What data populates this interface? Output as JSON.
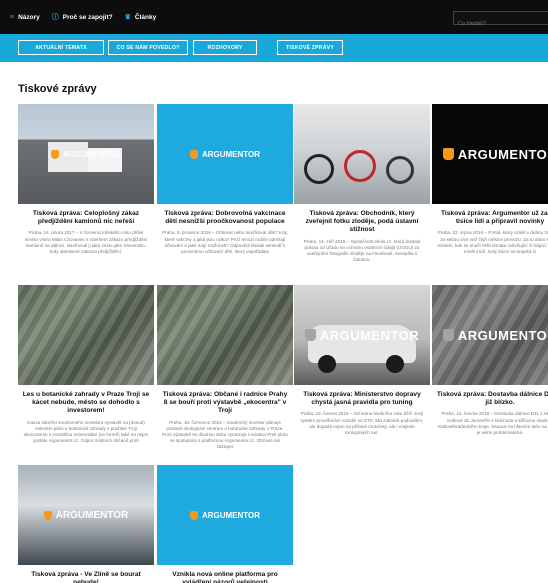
{
  "topnav": [
    {
      "icon": "≡",
      "label": "Názory"
    },
    {
      "icon": "ⓘ",
      "label": "Proč se zapojit?"
    },
    {
      "icon": "♛",
      "label": "Články"
    }
  ],
  "search": {
    "placeholder": "Co hledáš?"
  },
  "categories": [
    "AKTUÁLNÍ TÉMATA",
    "CO SE NÁM POVEDLO?",
    "ROZHOVORY",
    "TISKOVÉ ZPRÁVY"
  ],
  "page_title": "Tiskové zprávy",
  "brand": {
    "name": "ARGUMENTOR",
    "dot": "."
  },
  "cards": [
    {
      "title": "Tisková zpráva: Celoplošný zákaz předjíždění kamionů nic neřeší",
      "desc": "Praha, 14. února 2017 – V červenci loňského roku přišel ministr vnitra Milan Chovanec s návrhem zákazu předjíždění kamionů na dálnici. Navrhoval ji jako cestu jako Slovensko, tedy absolutně zákazat předjíždění."
    },
    {
      "title": "Tisková zpráva: Dobrovolná vakcinace dětí nesnížší proočkovanost populace",
      "desc": "Praha, 5. prosince 2016 – Očkovat nebo neočkovat děti? Kdy, které vakcíny a jaká jsou rizika? Proč mnozí rodiče odmítají očkování a jaké mají možnosti? Odpovědi hledali seminář k povinnému očkování dětí, který uspořádala"
    },
    {
      "title": "Tisková zpráva: Obchodník, který zveřejnil fotku zloděje, podá ústavní stížnost",
      "desc": "Praha, 14. září 2016 – Společnost ekolo.cz, která dostala pokutu od Úřadu na ochranu osobních údajů (ÚOOÚ) za uveřejnění fotografie zloděje na Facebook, neuspěla s žalobou."
    },
    {
      "title": "Tisková zpráva: Argumentor už zaujal tisíce lidí a připravil novinky",
      "desc": "Praha, 22. srpna 2016 – Portál, který vznikl v dubnu 2016 má za sebou více než čtyři měsíce provozu. Za tu dobu se stal místem, kde se snaží řešit témata ovlivňující či trápící veřejné mínění lidí. Svůj názor na krajská či"
    },
    {
      "title": "Les u botanické zahrady v Praze Troji se kácet nebude, město se dohodlo s investorem!",
      "desc": "Kauza záměru soukromého investora vystavět na (dosud) zeleném pláni u botanické zahrady v pražské Troji ekocentrum s rozsáhlou rezervoiální (ve formě) také na nejen portálu Argumentor.cz. Odpor místních občanů proti"
    },
    {
      "title": "Tisková zpráva: Občané i radnice Prahy 8 se bouří proti výstavbě „ekocentra\" v Troji",
      "desc": "Praha, 18. července 2016 – Soukromý investor plánuje postavit ekologické centrum u botanické zahrady v Praze. Proti výstavbě se dlouhou dobu vymezuje iniciativa Proti plotu ve spolupráci s platformou Argumentor.cz. Občané ani zástupci"
    },
    {
      "title": "Tisková zpráva: Ministerstvo dopravy chystá jasná pravidla pro tuning",
      "desc": "Praha, 23. června 2016 – Od ledna letošního roku běží nový systém prověřování vozidel na STK. Má zabránit podvodům, ale dopadá nejen na pěšové motoristy, ale i majitele tuningových aut."
    },
    {
      "title": "Tisková zpráva: Dostavba dálnice D11 je již blízko.",
      "desc": "Praha, 14. června 2016 – Dostavba dálnice D11 z Hradce Králové do Jaroměře a Náchoda a klíčovou stavbou Královéhradeckého kraje. Situace na hlavním tahu na Polsko je velmi problematická."
    },
    {
      "title": "Tisková zpráva - Ve Zlíně se bourat nebude!",
      "desc": ""
    },
    {
      "title": "Vznikla nová online platforma pro vyjádření názorů veřejnosti",
      "desc": ""
    }
  ]
}
